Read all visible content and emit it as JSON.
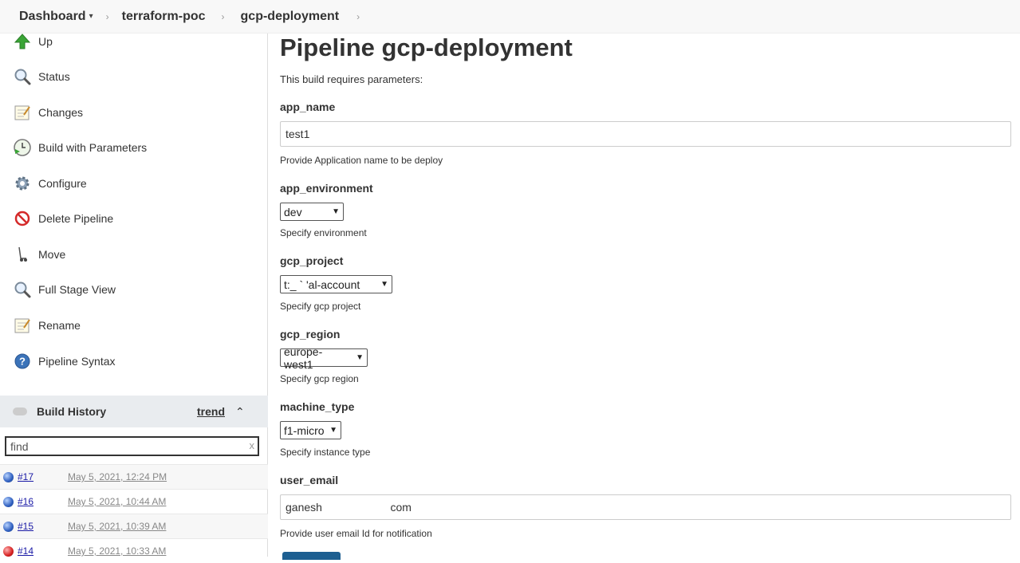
{
  "breadcrumb": {
    "items": [
      {
        "label": "Dashboard"
      },
      {
        "label": "terraform-poc"
      },
      {
        "label": "gcp-deployment"
      }
    ],
    "caret": "▾",
    "separator": "›"
  },
  "sidebar": {
    "tasks": [
      {
        "label": "Up",
        "icon": "up-arrow-icon"
      },
      {
        "label": "Status",
        "icon": "magnifier-icon"
      },
      {
        "label": "Changes",
        "icon": "notepad-icon"
      },
      {
        "label": "Build with Parameters",
        "icon": "clock-play-icon"
      },
      {
        "label": "Configure",
        "icon": "gear-icon"
      },
      {
        "label": "Delete Pipeline",
        "icon": "no-entry-icon"
      },
      {
        "label": "Move",
        "icon": "hand-truck-icon"
      },
      {
        "label": "Full Stage View",
        "icon": "magnifier-icon"
      },
      {
        "label": "Rename",
        "icon": "notepad-icon"
      },
      {
        "label": "Pipeline Syntax",
        "icon": "help-icon"
      }
    ],
    "build_history": {
      "title": "Build History",
      "trend": "trend",
      "collapse": "⌃",
      "filter_placeholder": "find",
      "filter_clear": "x",
      "builds": [
        {
          "number": "#17",
          "date": "May 5, 2021, 12:24 PM",
          "status": "blue"
        },
        {
          "number": "#16",
          "date": "May 5, 2021, 10:44 AM",
          "status": "blue"
        },
        {
          "number": "#15",
          "date": "May 5, 2021, 10:39 AM",
          "status": "blue"
        },
        {
          "number": "#14",
          "date": "May 5, 2021, 10:33 AM",
          "status": "red"
        }
      ]
    }
  },
  "main": {
    "title": "Pipeline gcp-deployment",
    "intro": "This build requires parameters:",
    "params": {
      "app_name": {
        "label": "app_name",
        "value": "test1",
        "desc": "Provide Application name to be deploy"
      },
      "app_environment": {
        "label": "app_environment",
        "value": "dev",
        "desc": "Specify environment"
      },
      "gcp_project": {
        "label": "gcp_project",
        "value": "t:_ ` 'al-account",
        "desc": "Specify gcp project"
      },
      "gcp_region": {
        "label": "gcp_region",
        "value": "europe-west1",
        "desc": "Specify gcp region"
      },
      "machine_type": {
        "label": "machine_type",
        "value": "f1-micro",
        "desc": "Specify instance type"
      },
      "user_email": {
        "label": "user_email",
        "value": "ganesh                      com",
        "desc": "Provide user email Id for notification"
      }
    }
  },
  "colors": {
    "build_button": "#1d5f91",
    "status_blue": "#2f5fbf",
    "status_red": "#d62020"
  }
}
